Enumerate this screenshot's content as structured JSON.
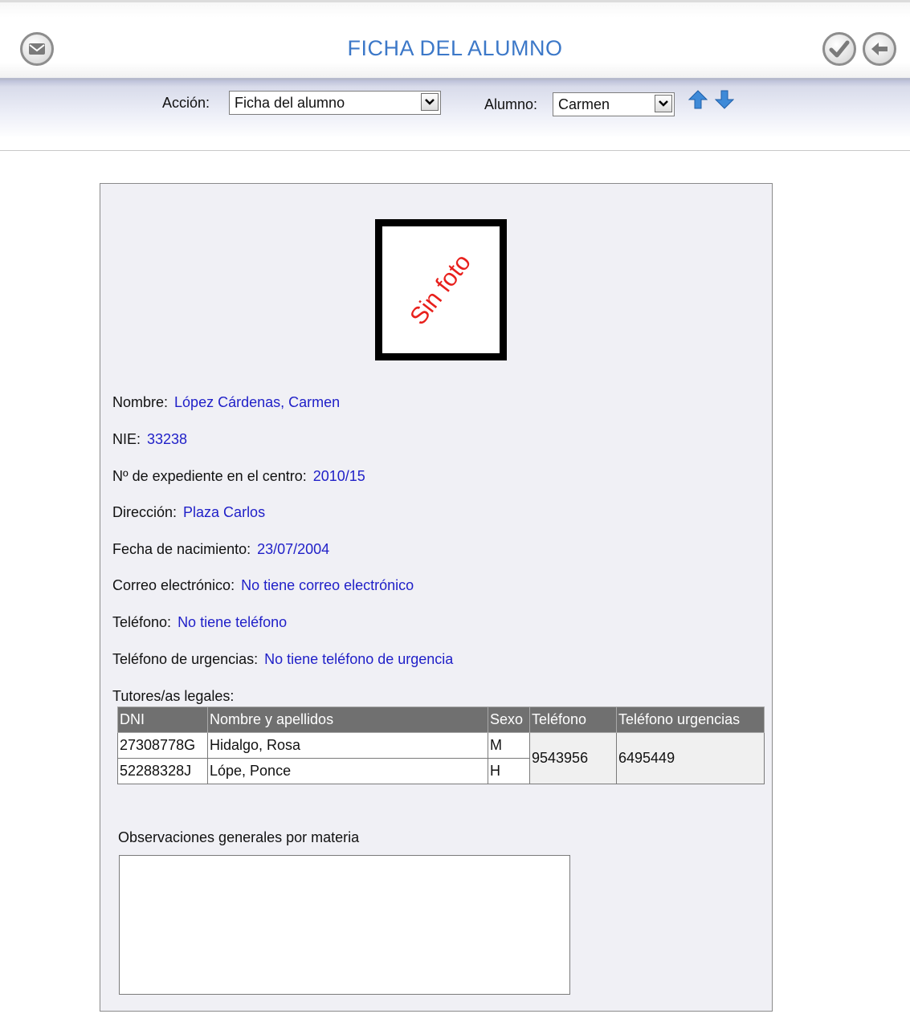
{
  "header": {
    "title": "FICHA DEL ALUMNO",
    "mail_icon": "envelope-icon",
    "confirm_icon": "check-icon",
    "back_icon": "arrow-left-icon"
  },
  "toolbar": {
    "accion_label": "Acción:",
    "accion_value": "Ficha del alumno",
    "alumno_label": "Alumno:",
    "alumno_value": "Carmen",
    "up_icon": "arrow-up-icon",
    "down_icon": "arrow-down-icon"
  },
  "photo": {
    "text": "Sin foto"
  },
  "fields": {
    "nombre": {
      "label": "Nombre:",
      "value": "López Cárdenas, Carmen"
    },
    "nie": {
      "label": "NIE:",
      "value": "33238"
    },
    "expediente": {
      "label": "Nº de expediente en el centro:",
      "value": "2010/15"
    },
    "direccion": {
      "label": "Dirección:",
      "value": "Plaza Carlos"
    },
    "nacimiento": {
      "label": "Fecha de nacimiento:",
      "value": "23/07/2004"
    },
    "correo": {
      "label": "Correo electrónico:",
      "value": "No tiene correo electrónico"
    },
    "telefono": {
      "label": "Teléfono:",
      "value": "No tiene teléfono"
    },
    "urgencias": {
      "label": "Teléfono de urgencias:",
      "value": "No tiene teléfono de urgencia"
    }
  },
  "tutors": {
    "label": "Tutores/as legales:",
    "headers": [
      "DNI",
      "Nombre y apellidos",
      "Sexo",
      "Teléfono",
      "Teléfono urgencias"
    ],
    "rows": [
      {
        "dni": "27308778G",
        "nombre": "Hidalgo, Rosa",
        "sexo": "M"
      },
      {
        "dni": "52288328J",
        "nombre": "Lópe, Ponce",
        "sexo": "H"
      }
    ],
    "telefono": "9543956",
    "telefono_urgencias": "6495449"
  },
  "observaciones": {
    "label": "Observaciones generales por materia",
    "value": ""
  },
  "colors": {
    "title": "#3c78c8",
    "value_text": "#1f1fc8",
    "no_photo": "#e8201c",
    "table_header": "#707070"
  }
}
